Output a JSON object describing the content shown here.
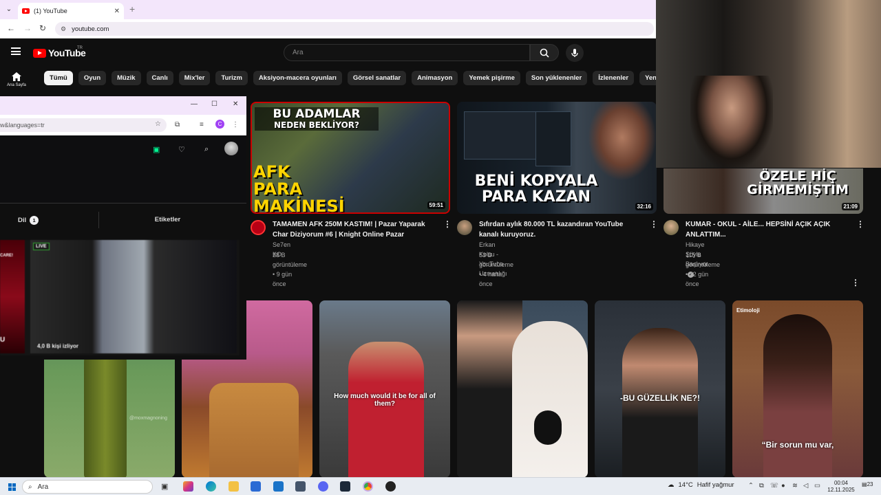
{
  "browser": {
    "tab_title": "(1) YouTube",
    "url": "youtube.com"
  },
  "youtube": {
    "logo_text": "YouTube",
    "country_code": "TR",
    "search_placeholder": "Ara",
    "home_label": "Ana Sayfa",
    "chips": [
      "Tümü",
      "Oyun",
      "Müzik",
      "Canlı",
      "Mix'ler",
      "Turizm",
      "Aksiyon-macera oyunları",
      "Görsel sanatlar",
      "Animasyon",
      "Yemek pişirme",
      "Son yüklenenler",
      "İzlenenler",
      "Yeni öneriler"
    ],
    "videos": [
      {
        "title_line1": "TAMAMEN AFK 250M KASTIM! | Pazar Yaparak",
        "title_line2": "Char Diziyorum #6 | Knight Online Pazar",
        "channel": "Se7en KO",
        "stats": "28 B görüntüleme • 9 gün önce",
        "duration": "59:51",
        "thumb_text": [
          "BU ADAMLAR",
          "NEDEN BEKLİYOR?",
          "AFK",
          "PARA",
          "MAKİNESİ"
        ]
      },
      {
        "title_line1": "Sıfırdan aylık 80.000 TL kazandıran YouTube",
        "title_line2": "kanalı kuruyoruz.",
        "channel": "Erkan Kolcu - YouTube Uzmanlığı",
        "stats": "53 B görüntüleme • 4 hafta önce",
        "duration": "32:16",
        "thumb_text": [
          "BENİ KOPYALA",
          "PARA KAZAN"
        ]
      },
      {
        "title_line1": "KUMAR - OKUL - AİLE... HEPSİNİ AÇIK AÇIK",
        "title_line2": "ANLATTIM...",
        "channel": "Hikaye Şöyle Başlıyor",
        "stats": "115 B görüntüleme • 12 gün önce",
        "duration": "21:09",
        "thumb_text": [
          "ÖZELE HİÇ",
          "GİRMEMİŞTİM"
        ]
      }
    ],
    "shorts_captions": [
      "@moxmagnoning",
      "How much would it be for all of them?",
      "-BU GÜZELLİK NE?!",
      "Etimoloji",
      "“Bir sorun mu var,"
    ]
  },
  "second_window": {
    "url_fragment": "w&languages=tr",
    "profile_initial": "C",
    "filter_tab": "Dil",
    "filter_count": "1",
    "tags_tab": "Etiketler",
    "live_badge": "LIVE",
    "viewers": "4,0 B kişi izliyor",
    "left_tile_text": "CARE!",
    "left_tile_letter": "U"
  },
  "taskbar": {
    "search_text": "Ara",
    "temperature": "14°C",
    "weather": "Hafif yağmur",
    "time": "00:04",
    "date": "12.11.2025",
    "notifications": "23"
  },
  "colors": {
    "youtube_red": "#ff0000",
    "chip_active_bg": "#f1f1f1",
    "chip_bg": "#272727",
    "browser_frame": "#f3e6fb",
    "twitch_accent": "#00f593"
  }
}
